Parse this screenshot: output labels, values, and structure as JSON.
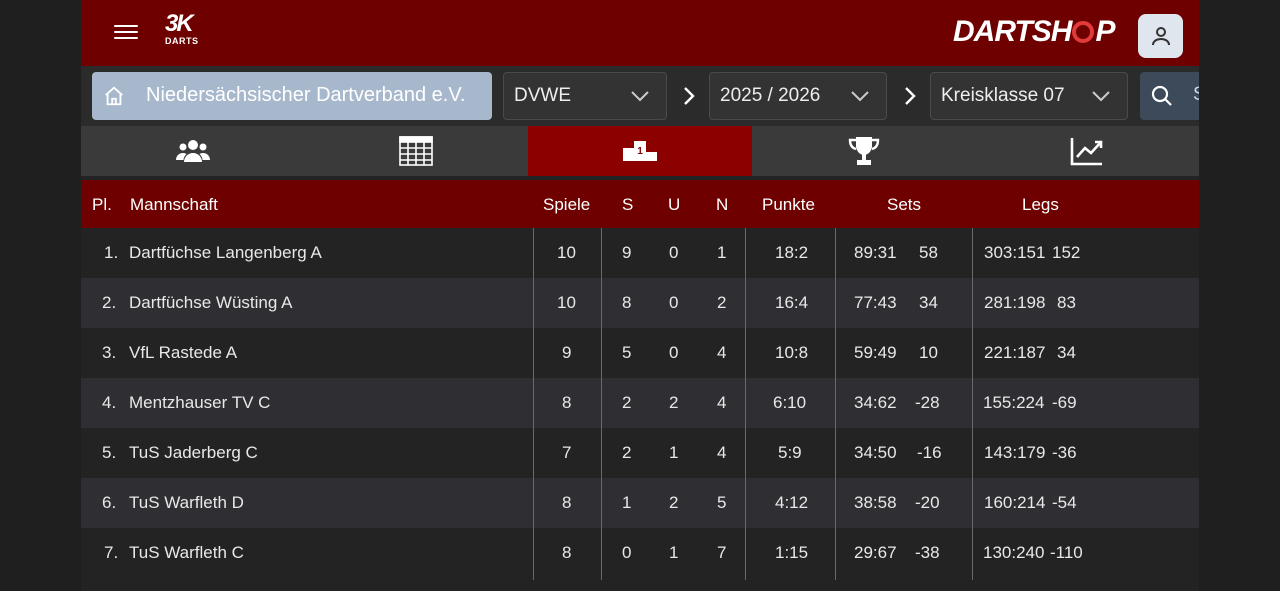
{
  "header": {
    "logo_big": "3K",
    "logo_small": "DARTS",
    "shop_logo_left": "DARTSH",
    "shop_logo_right": "P"
  },
  "filters": {
    "federation": "Niedersächsischer Dartverband e.V.",
    "region": "DVWE",
    "season": "2025 / 2026",
    "league": "Kreisklasse 07",
    "search_label": "S"
  },
  "tabs": [
    {
      "icon": "team-icon",
      "active": false
    },
    {
      "icon": "calendar-grid-icon",
      "active": false
    },
    {
      "icon": "podium-icon",
      "active": true
    },
    {
      "icon": "trophy-icon",
      "active": false
    },
    {
      "icon": "chart-icon",
      "active": false
    }
  ],
  "table": {
    "headers": {
      "place": "Pl.",
      "team": "Mannschaft",
      "games": "Spiele",
      "wins": "S",
      "draws": "U",
      "losses": "N",
      "points": "Punkte",
      "sets": "Sets",
      "legs": "Legs"
    },
    "rows": [
      {
        "place": "1.",
        "team": "Dartfüchse Langenberg A",
        "games": "10",
        "wins": "9",
        "draws": "0",
        "losses": "1",
        "points": "18:2",
        "sets": "89:31",
        "sets_diff": "58",
        "legs": "303:151",
        "legs_diff": "152"
      },
      {
        "place": "2.",
        "team": "Dartfüchse Wüsting A",
        "games": "10",
        "wins": "8",
        "draws": "0",
        "losses": "2",
        "points": "16:4",
        "sets": "77:43",
        "sets_diff": "34",
        "legs": "281:198",
        "legs_diff": "83"
      },
      {
        "place": "3.",
        "team": "VfL Rastede A",
        "games": "9",
        "wins": "5",
        "draws": "0",
        "losses": "4",
        "points": "10:8",
        "sets": "59:49",
        "sets_diff": "10",
        "legs": "221:187",
        "legs_diff": "34"
      },
      {
        "place": "4.",
        "team": "Mentzhauser TV C",
        "games": "8",
        "wins": "2",
        "draws": "2",
        "losses": "4",
        "points": "6:10",
        "sets": "34:62",
        "sets_diff": "-28",
        "legs": "155:224",
        "legs_diff": "-69"
      },
      {
        "place": "5.",
        "team": "TuS Jaderberg C",
        "games": "7",
        "wins": "2",
        "draws": "1",
        "losses": "4",
        "points": "5:9",
        "sets": "34:50",
        "sets_diff": "-16",
        "legs": "143:179",
        "legs_diff": "-36"
      },
      {
        "place": "6.",
        "team": "TuS Warfleth D",
        "games": "8",
        "wins": "1",
        "draws": "2",
        "losses": "5",
        "points": "4:12",
        "sets": "38:58",
        "sets_diff": "-20",
        "legs": "160:214",
        "legs_diff": "-54"
      },
      {
        "place": "7.",
        "team": "TuS Warfleth C",
        "games": "8",
        "wins": "0",
        "draws": "1",
        "losses": "7",
        "points": "1:15",
        "sets": "29:67",
        "sets_diff": "-38",
        "legs": "130:240",
        "legs_diff": "-110"
      }
    ]
  },
  "colors": {
    "header_red": "#6e0000",
    "active_tab": "#8c0000",
    "federation_bg": "#a8b8cc"
  }
}
